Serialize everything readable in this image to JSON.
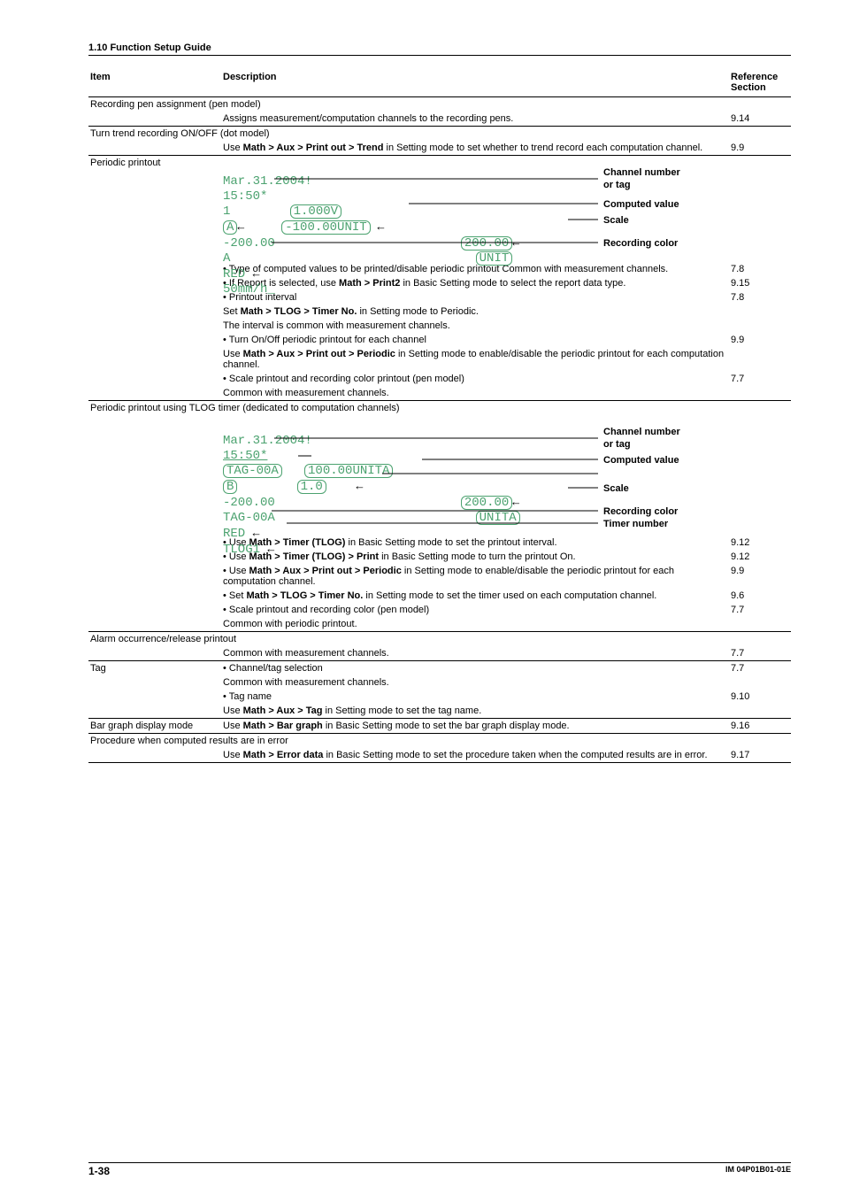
{
  "section_header": "1.10  Function Setup Guide",
  "columns": {
    "item": "Item",
    "desc": "Description",
    "ref": "Reference Section"
  },
  "rows": {
    "rec_pen": {
      "item": "Recording pen assignment (pen model)",
      "desc": "Assigns measurement/computation channels to the recording pens.",
      "ref": "9.14"
    },
    "trend": {
      "item": "Turn trend recording ON/OFF (dot model)",
      "desc1": "Use ",
      "desc1b": "Math > Aux > Print out > Trend",
      "desc1c": " in Setting mode to set whether to trend record each computation channel.",
      "ref": "9.9"
    },
    "periodic": {
      "item": "Periodic printout",
      "b1": "Type of computed values to be printed/disable periodic printout Common with measurement channels.",
      "r1": "7.8",
      "b2a": "If Report is selected, use ",
      "b2b": "Math > Print2",
      "b2c": " in Basic Setting mode to select the report data type.",
      "r2": "9.15",
      "b3": "Printout interval",
      "r3": "7.8",
      "b3s1a": "Set ",
      "b3s1b": "Math > TLOG > Timer No.",
      "b3s1c": " in Setting mode to Periodic.",
      "b3s2": "The interval is common with measurement channels.",
      "b4": "Turn On/Off periodic printout for each channel",
      "r4": "9.9",
      "b4s1a": "Use ",
      "b4s1b": "Math > Aux > Print out > Periodic",
      "b4s1c": " in Setting mode to enable/disable the periodic printout for each computation channel.",
      "b5": "Scale printout and recording color printout (pen model)",
      "r5": "7.7",
      "b5s": "Common with measurement channels."
    },
    "tlog": {
      "item": "Periodic printout using TLOG timer (dedicated to computation channels)",
      "b1a": "Use ",
      "b1b": "Math > Timer (TLOG)",
      "b1c": " in Basic Setting mode to set the printout interval.",
      "r1": "9.12",
      "b2a": "Use ",
      "b2b": "Math > Timer (TLOG) > Print",
      "b2c": " in Basic Setting mode to turn the printout On.",
      "r2": "9.12",
      "b3a": "Use ",
      "b3b": "Math > Aux > Print out > Periodic",
      "b3c": " in Setting mode to enable/disable the periodic printout for each computation channel.",
      "r3": "9.9",
      "b4a": "Set ",
      "b4b": "Math > TLOG > Timer No.",
      "b4c": " in Setting mode to set the timer used on each computation channel.",
      "r4": "9.6",
      "b5": "Scale printout and recording color (pen model)",
      "r5": "7.7",
      "b5s": "Common with periodic printout."
    },
    "alarm": {
      "item": "Alarm occurrence/release printout",
      "desc": "Common with measurement channels.",
      "ref": "7.7"
    },
    "tag": {
      "item": "Tag",
      "b1": "Channel/tag selection",
      "r1": "7.7",
      "b1s": "Common with measurement channels.",
      "b2": "Tag name",
      "r2": "9.10",
      "b2sa": "Use ",
      "b2sb": "Math > Aux > Tag",
      "b2sc": " in Setting mode to set the tag name."
    },
    "bar": {
      "item": "Bar graph display mode",
      "desc_a": "Use ",
      "desc_b": "Math > Bar graph",
      "desc_c": " in Basic Setting mode to set the bar graph display mode.",
      "ref": "9.16"
    },
    "err": {
      "item": "Procedure when computed results are in error",
      "desc_a": "Use ",
      "desc_b": "Math > Error data",
      "desc_c": " in Basic Setting mode to set the procedure taken when the computed results are in error.",
      "ref": "9.17"
    }
  },
  "fig1": {
    "l1": "Mar.31.2004!",
    "l2": "15:50*",
    "l3a": "1",
    "l3b": "1.000V",
    "l4a": "A",
    "l4b": "-100.00UNIT",
    "l5a": "-200.00",
    "l5b": "200.00",
    "l6a": "A",
    "l6b": "UNIT",
    "l7": "RED",
    "l8": "50mm/h_",
    "labels": {
      "ch": "Channel number",
      "tag": "or tag",
      "cv": "Computed value",
      "scale": "Scale",
      "rc": "Recording color"
    }
  },
  "fig2": {
    "l1": "Mar.31.2004!",
    "l2": "15:50*",
    "l3a": "TAG-00A",
    "l3b": "100.00UNITA",
    "l4a": "B",
    "l4b": "1.0",
    "l5a": "-200.00",
    "l5b": "200.00",
    "l6a": "TAG-00A",
    "l6b": "UNITA",
    "l7": "RED",
    "l8": "TLOG1",
    "labels": {
      "ch": "Channel number",
      "tag": "or tag",
      "cv": "Computed value",
      "scale": "Scale",
      "rc": "Recording color",
      "tn": "Timer number"
    }
  },
  "footer": {
    "page": "1-38",
    "code": "IM 04P01B01-01E"
  }
}
